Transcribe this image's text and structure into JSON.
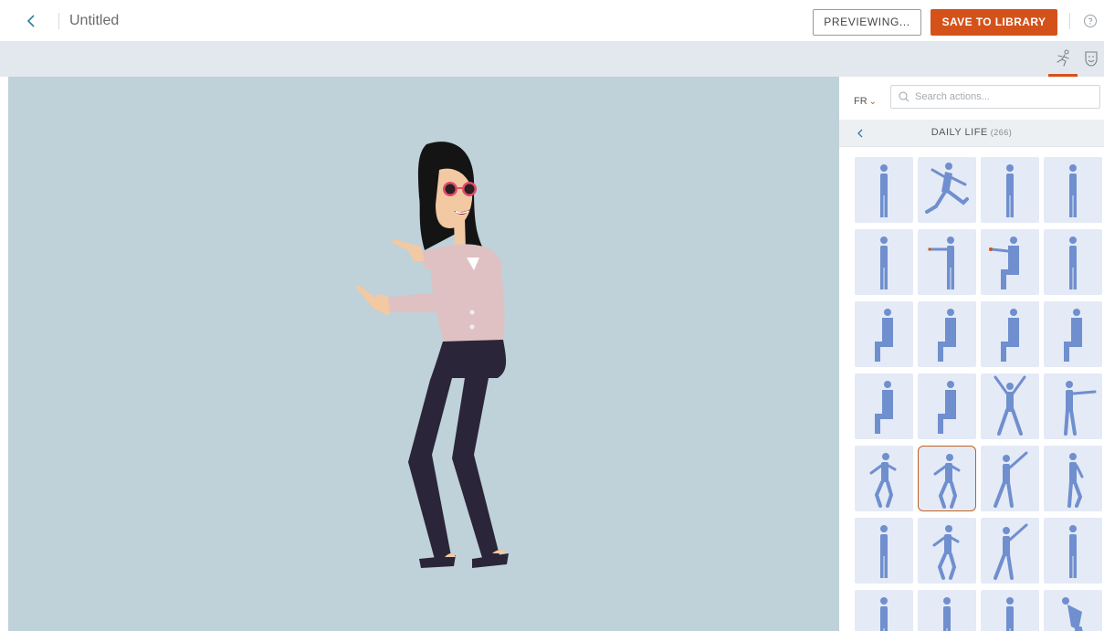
{
  "header": {
    "title": "Untitled",
    "preview_label": "PREVIEWING...",
    "save_label": "SAVE TO LIBRARY"
  },
  "panel": {
    "language": "FR",
    "search_placeholder": "Search actions...",
    "category": "DAILY LIFE",
    "category_count": "(266)"
  },
  "colors": {
    "accent": "#d4521a",
    "stage_bg": "#bfd1d9",
    "tile_bg": "#e4eaf6",
    "figure": "#6f8fcf"
  },
  "actions": [
    {
      "icon": "stand-hands-pocket-icon"
    },
    {
      "icon": "run-icon",
      "pose": "run"
    },
    {
      "icon": "stand-icon"
    },
    {
      "icon": "stand-lean-icon"
    },
    {
      "icon": "stand-hand-on-hip-icon"
    },
    {
      "icon": "point-left-icon",
      "pose": "point-left"
    },
    {
      "icon": "sit-point-icon",
      "pose": "sit-point"
    },
    {
      "icon": "stand-hands-head-icon"
    },
    {
      "icon": "sit-drink-icon",
      "pose": "sit"
    },
    {
      "icon": "sit-phone-icon",
      "pose": "sit"
    },
    {
      "icon": "sit-think-icon",
      "pose": "sit"
    },
    {
      "icon": "sit-lean-icon",
      "pose": "sit"
    },
    {
      "icon": "sit-icon",
      "pose": "sit"
    },
    {
      "icon": "sit-relax-icon",
      "pose": "sit"
    },
    {
      "icon": "cheer-icon",
      "pose": "cheer"
    },
    {
      "icon": "point-right-icon",
      "pose": "point-right"
    },
    {
      "icon": "dance-icon",
      "pose": "dance"
    },
    {
      "icon": "dance-point-icon",
      "pose": "dance",
      "selected": true
    },
    {
      "icon": "dance-wave-icon",
      "pose": "dance-wave"
    },
    {
      "icon": "walk-icon",
      "pose": "walk"
    },
    {
      "icon": "stand-shrug-icon"
    },
    {
      "icon": "dance-step-icon",
      "pose": "dance"
    },
    {
      "icon": "lean-back-icon",
      "pose": "dance-wave"
    },
    {
      "icon": "stand-tablet-icon"
    },
    {
      "icon": "stand-phone-icon"
    },
    {
      "icon": "stand-box-icon"
    },
    {
      "icon": "stand-arms-out-icon"
    },
    {
      "icon": "bend-over-icon",
      "pose": "bend"
    }
  ]
}
